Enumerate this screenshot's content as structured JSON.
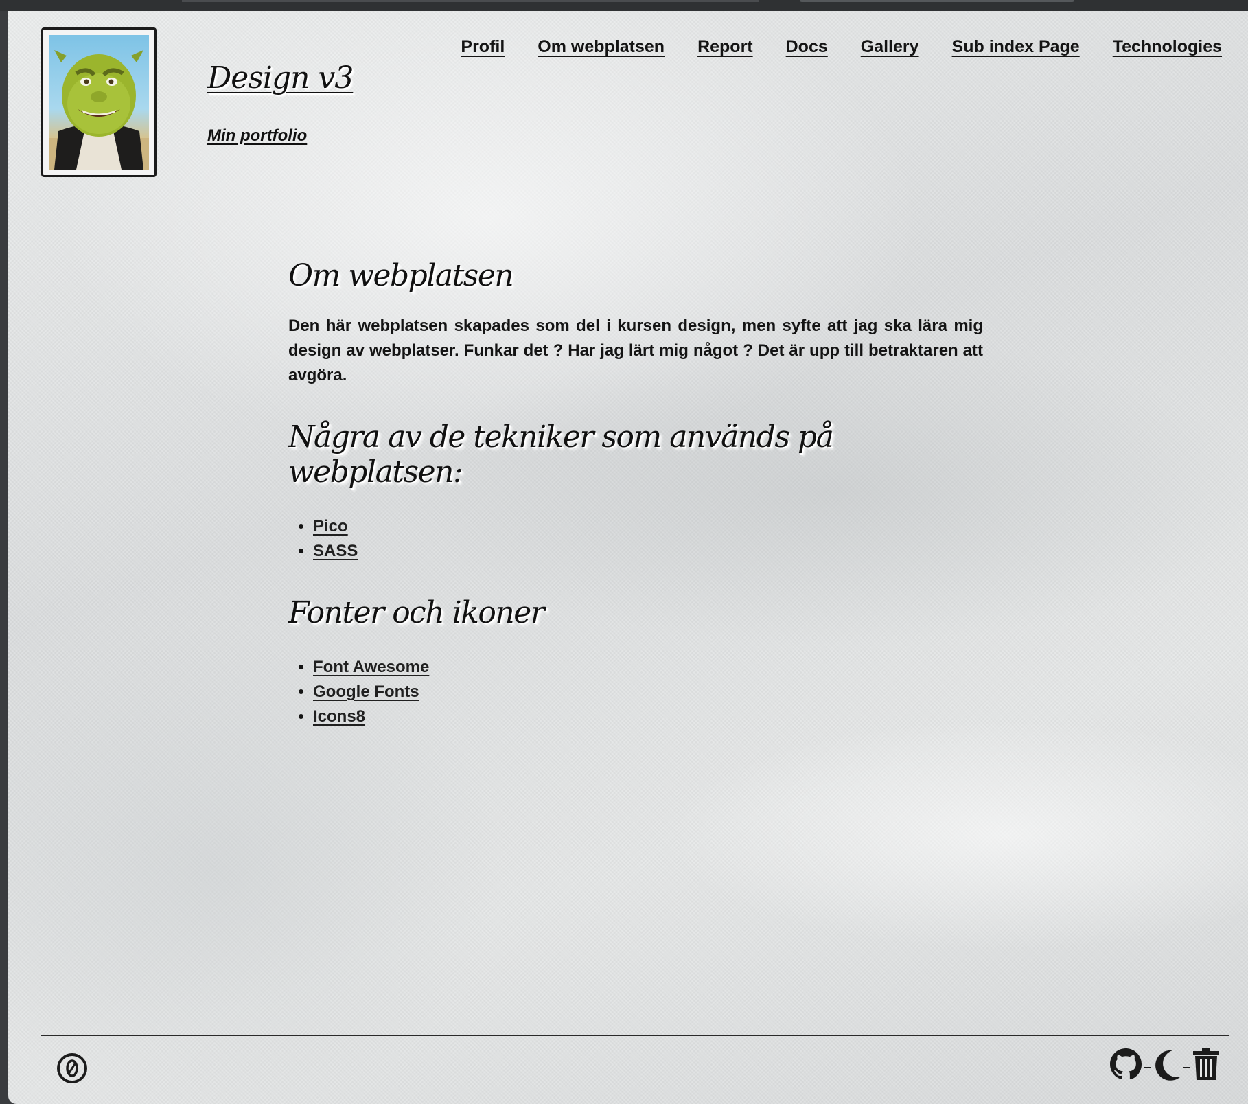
{
  "site": {
    "title": "Design v3",
    "tagline": "Min portfolio"
  },
  "nav": {
    "items": [
      {
        "label": "Profil"
      },
      {
        "label": "Om webplatsen"
      },
      {
        "label": "Report"
      },
      {
        "label": "Docs"
      },
      {
        "label": "Gallery"
      },
      {
        "label": "Sub index Page"
      },
      {
        "label": "Technologies"
      }
    ]
  },
  "main": {
    "heading": "Om webplatsen",
    "intro": "Den här webplatsen skapades som del i kursen design, men syfte att jag ska lära mig design av webplatser. Funkar det ? Har jag lärt mig något ? Det är upp till betraktaren att avgöra.",
    "techniques_heading": "Några av de tekniker som används på webplatsen:",
    "techniques": [
      "Pico",
      "SASS"
    ],
    "fonts_heading": "Fonter och ikoner",
    "fonts": [
      "Font Awesome",
      "Google Fonts",
      "Icons8"
    ]
  },
  "footer": {
    "left_icon": "zero-circle-icon",
    "right_icons": [
      "github-icon",
      "moon-icon",
      "trash-icon"
    ]
  },
  "colors": {
    "text": "#141414",
    "accent_border": "#1b1b1b",
    "browser_chrome": "#3a3c3f"
  }
}
